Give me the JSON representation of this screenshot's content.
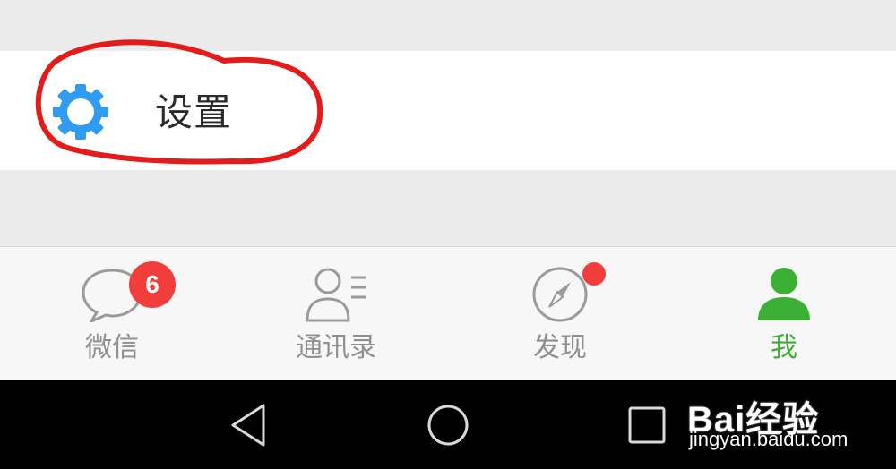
{
  "settings": {
    "label": "设置",
    "icon": "gear-icon",
    "icon_color": "#2f9cf2"
  },
  "annotation": {
    "color": "#e31b1b"
  },
  "tabbar": {
    "tabs": [
      {
        "label": "微信",
        "icon": "chat-bubble-icon",
        "badge": "6",
        "active": false
      },
      {
        "label": "通讯录",
        "icon": "contacts-icon",
        "active": false
      },
      {
        "label": "发现",
        "icon": "compass-icon",
        "dot": true,
        "active": false
      },
      {
        "label": "我",
        "icon": "person-icon",
        "active": true
      }
    ],
    "active_color": "#3cb035",
    "inactive_color": "#8f8f8f",
    "badge_color": "#f23d3d"
  },
  "navbar": {
    "buttons": [
      "back-icon",
      "home-icon",
      "recents-icon"
    ]
  },
  "watermark": {
    "brand": "Bai经验",
    "url": "jingyan.baidu.com"
  }
}
